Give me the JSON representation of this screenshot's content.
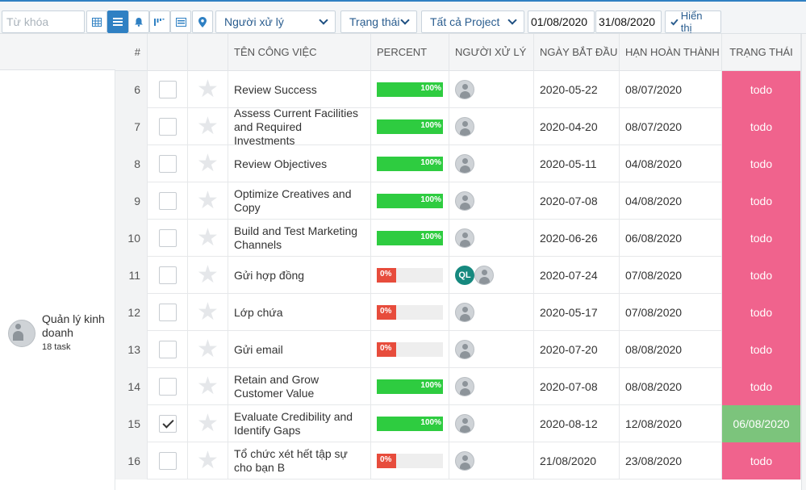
{
  "toolbar": {
    "keyword_placeholder": "Từ khóa",
    "assignee_select": "Người xử lý",
    "status_select": "Trạng thái",
    "project_select": "Tất cả Project",
    "date_from": "01/08/2020",
    "date_to": "31/08/2020",
    "show_button": "Hiển thị",
    "icons": [
      "grid-view-icon",
      "list-view-icon",
      "bell-icon",
      "gantt-icon",
      "card-icon",
      "map-pin-icon"
    ]
  },
  "group": {
    "name": "Quản lý kinh doanh",
    "count": "18 task"
  },
  "columns": {
    "num": "#",
    "name": "TÊN CÔNG VIỆC",
    "percent": "PERCENT",
    "assignee": "NGƯỜI XỬ LÝ",
    "start": "NGÀY BẮT ĐẦU",
    "due": "HẠN HOÀN THÀNH",
    "status": "TRẠNG THÁI"
  },
  "rows": [
    {
      "num": "6",
      "checked": false,
      "name": "Review Success",
      "percent": "100%",
      "ql": "",
      "start": "2020-05-22",
      "due": "08/07/2020",
      "status": "todo"
    },
    {
      "num": "7",
      "checked": false,
      "name": "Assess Current Facilities and Required Investments",
      "percent": "100%",
      "ql": "",
      "start": "2020-04-20",
      "due": "08/07/2020",
      "status": "todo"
    },
    {
      "num": "8",
      "checked": false,
      "name": "Review Objectives",
      "percent": "100%",
      "ql": "",
      "start": "2020-05-11",
      "due": "04/08/2020",
      "status": "todo"
    },
    {
      "num": "9",
      "checked": false,
      "name": "Optimize Creatives and Copy",
      "percent": "100%",
      "ql": "",
      "start": "2020-07-08",
      "due": "04/08/2020",
      "status": "todo"
    },
    {
      "num": "10",
      "checked": false,
      "name": "Build and Test Marketing Channels",
      "percent": "100%",
      "ql": "",
      "start": "2020-06-26",
      "due": "06/08/2020",
      "status": "todo"
    },
    {
      "num": "11",
      "checked": false,
      "name": "Gửi hợp đồng",
      "percent": "0%",
      "ql": "QL",
      "start": "2020-07-24",
      "due": "07/08/2020",
      "status": "todo"
    },
    {
      "num": "12",
      "checked": false,
      "name": "Lớp chứa",
      "percent": "0%",
      "ql": "",
      "start": "2020-05-17",
      "due": "07/08/2020",
      "status": "todo"
    },
    {
      "num": "13",
      "checked": false,
      "name": "Gửi email",
      "percent": "0%",
      "ql": "",
      "start": "2020-07-20",
      "due": "08/08/2020",
      "status": "todo"
    },
    {
      "num": "14",
      "checked": false,
      "name": "Retain and Grow Customer Value",
      "percent": "100%",
      "ql": "",
      "start": "2020-07-08",
      "due": "08/08/2020",
      "status": "todo"
    },
    {
      "num": "15",
      "checked": true,
      "name": "Evaluate Credibility and Identify Gaps",
      "percent": "100%",
      "ql": "",
      "start": "2020-08-12",
      "due": "12/08/2020",
      "status": "06/08/2020"
    },
    {
      "num": "16",
      "checked": false,
      "name": "Tổ chức xét hết tập sự cho bạn B",
      "percent": "0%",
      "ql": "",
      "start": "21/08/2020",
      "due": "23/08/2020",
      "status": "todo"
    }
  ],
  "colors": {
    "accent": "#2f80c3",
    "todo": "#f0638d",
    "done": "#7cc47c",
    "bar_full": "#2ecc40",
    "bar_zero": "#e74c3c"
  }
}
